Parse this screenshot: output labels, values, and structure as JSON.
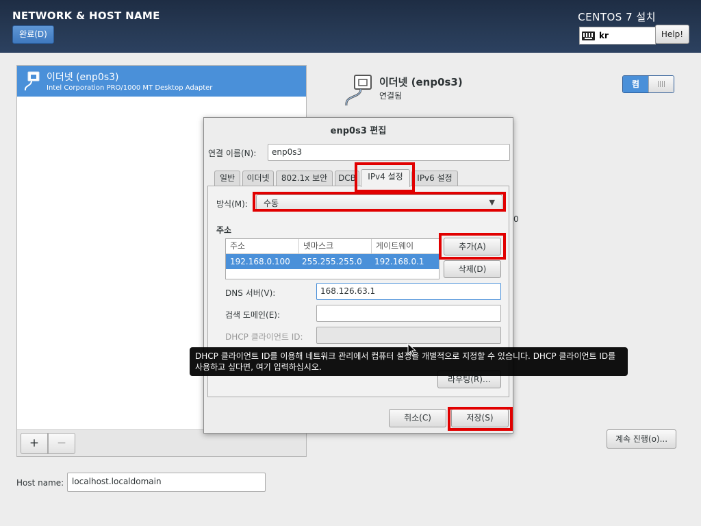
{
  "header": {
    "title": "NETWORK & HOST NAME",
    "done_label": "완료(D)",
    "product": "CENTOS 7 설치",
    "keyboard_layout": "kr",
    "help_label": "Help!"
  },
  "devices": {
    "items": [
      {
        "name": "이더넷 (enp0s3)",
        "description": "Intel Corporation PRO/1000 MT Desktop Adapter",
        "icon": "network-wired-icon",
        "selected": true
      }
    ],
    "add_label": "+",
    "remove_label": "−"
  },
  "detail": {
    "name": "이더넷 (enp0s3)",
    "status": "연결됨",
    "switch_label": "켬",
    "stray_text": "0",
    "continue_label": "계속 진행(o)..."
  },
  "hostname": {
    "label": "Host name:",
    "value": "localhost.localdomain"
  },
  "dialog": {
    "title": "enp0s3 편집",
    "conn_name_label": "연결 이름(N):",
    "conn_name_value": "enp0s3",
    "tabs": [
      {
        "label": "일반",
        "active": false
      },
      {
        "label": "이더넷",
        "active": false
      },
      {
        "label": "802.1x 보안",
        "active": false
      },
      {
        "label": "DCB",
        "active": false
      },
      {
        "label": "IPv4 설정",
        "active": true
      },
      {
        "label": "IPv6 설정",
        "active": false
      }
    ],
    "method_label": "방식(M):",
    "method_value": "수동",
    "address_heading": "주소",
    "address_columns": [
      "주소",
      "넷마스크",
      "게이트웨이"
    ],
    "address_rows": [
      [
        "192.168.0.100",
        "255.255.255.0",
        "192.168.0.1"
      ]
    ],
    "add_button": "추가(A)",
    "delete_button": "삭제(D)",
    "dns_label": "DNS 서버(V):",
    "dns_value": "168.126.63.1",
    "search_label": "검색 도메인(E):",
    "search_value": "",
    "dhcp_label": "DHCP 클라이언트 ID:",
    "dhcp_value": "",
    "routes_button": "라우팅(R)…",
    "cancel_button": "취소(C)",
    "save_button": "저장(S)"
  },
  "tooltip": "DHCP 클라이언트 ID를 이용해 네트워크 관리에서 컴퓨터 설정을 개별적으로 지정할 수 있습니다. DHCP 클라이언트 ID를 사용하고 싶다면, 여기 입력하십시오.",
  "colors": {
    "accent": "#4a90d9",
    "header_bg": "#22324b",
    "highlight": "#e10000"
  }
}
